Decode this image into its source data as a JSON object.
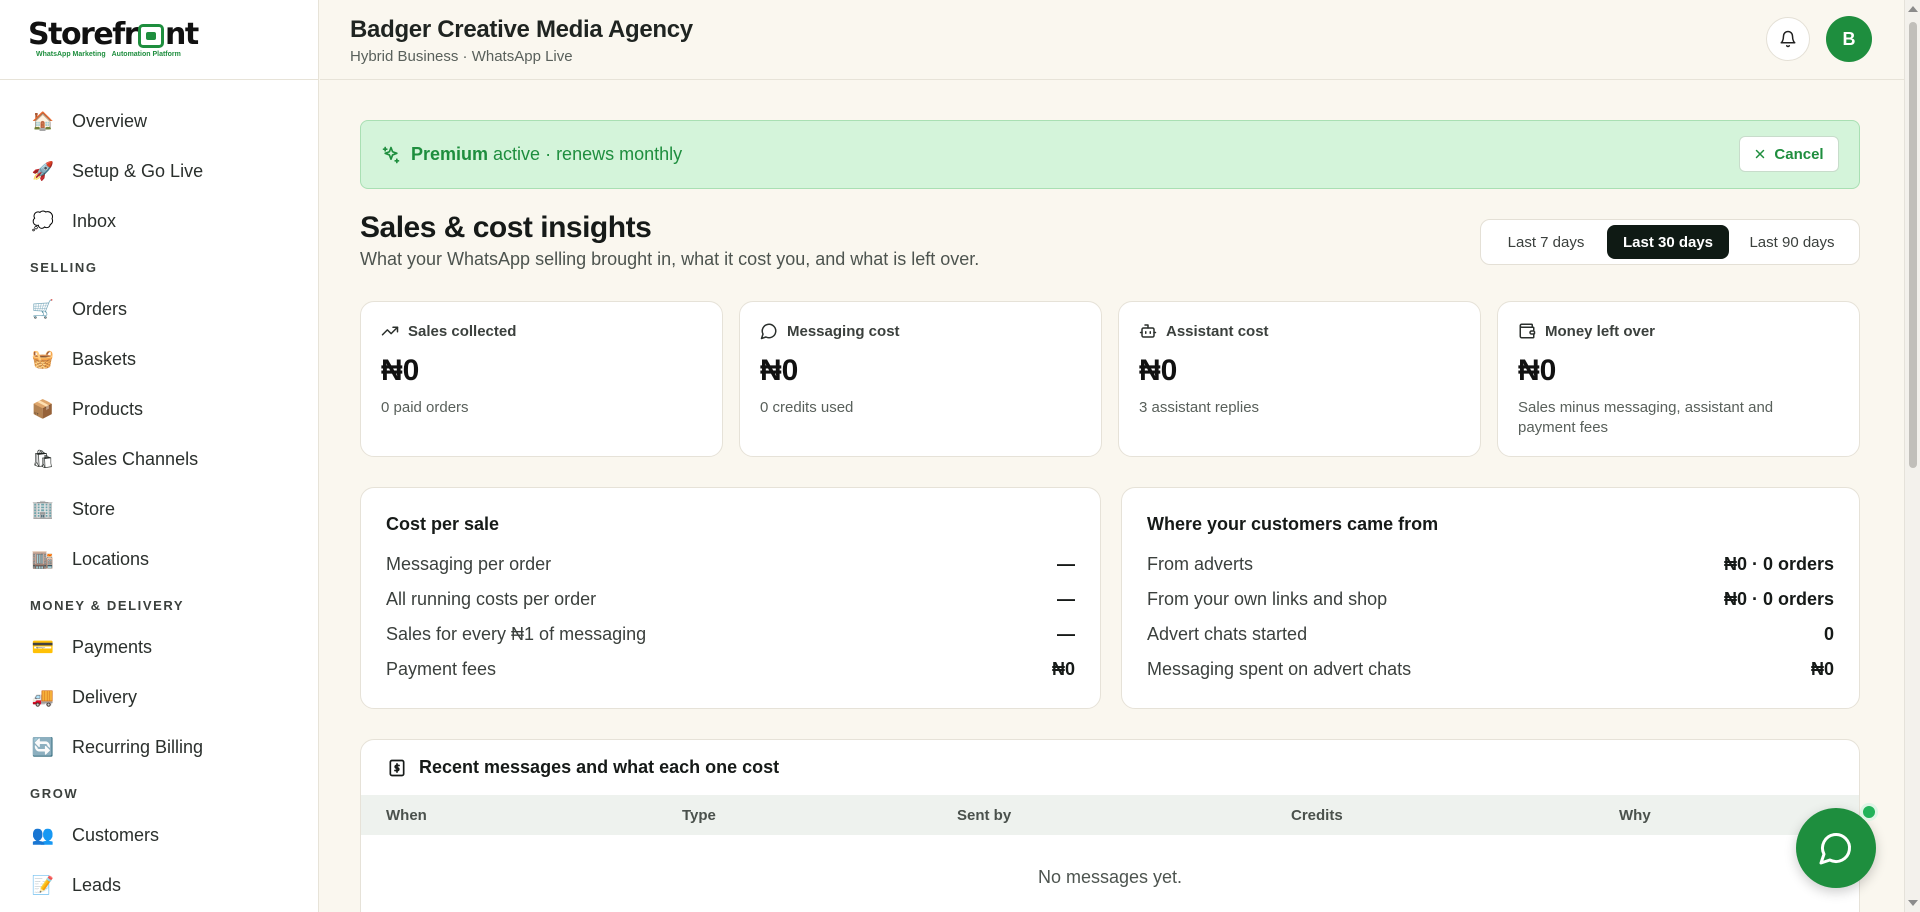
{
  "brand": {
    "logo_text_1": "Storefr",
    "logo_text_2": "nt",
    "tagline_1": "WhatsApp Marketing",
    "tagline_2": "Automation Platform"
  },
  "header": {
    "business_name": "Badger Creative Media Agency",
    "business_sub": "Hybrid Business · WhatsApp Live",
    "avatar_initial": "B"
  },
  "sidebar": {
    "top_items": [
      {
        "label": "Overview",
        "icon": "🏠"
      },
      {
        "label": "Setup & Go Live",
        "icon": "🚀"
      },
      {
        "label": "Inbox",
        "icon": "💭"
      }
    ],
    "selling_title": "SELLING",
    "selling_items": [
      {
        "label": "Orders",
        "icon": "🛒"
      },
      {
        "label": "Baskets",
        "icon": "🧺"
      },
      {
        "label": "Products",
        "icon": "📦"
      },
      {
        "label": "Sales Channels",
        "icon": "🛍"
      },
      {
        "label": "Store",
        "icon": "🏢"
      },
      {
        "label": "Locations",
        "icon": "🏬"
      }
    ],
    "money_title": "MONEY & DELIVERY",
    "money_items": [
      {
        "label": "Payments",
        "icon": "💳"
      },
      {
        "label": "Delivery",
        "icon": "🚚"
      },
      {
        "label": "Recurring Billing",
        "icon": "🔄"
      }
    ],
    "grow_title": "GROW",
    "grow_items": [
      {
        "label": "Customers",
        "icon": "👥"
      },
      {
        "label": "Leads",
        "icon": "📝"
      }
    ]
  },
  "banner": {
    "plan": "Premium",
    "status": "active · renews monthly",
    "cancel_label": "Cancel"
  },
  "page": {
    "title": "Sales & cost insights",
    "subtitle": "What your WhatsApp selling brought in, what it cost you, and what is left over.",
    "ranges": [
      "Last 7 days",
      "Last 30 days",
      "Last 90 days"
    ],
    "selected_range": "Last 30 days"
  },
  "stats": [
    {
      "label": "Sales collected",
      "value": "₦0",
      "note": "0 paid orders",
      "icon": "trending-up-icon"
    },
    {
      "label": "Messaging cost",
      "value": "₦0",
      "note": "0 credits used",
      "icon": "message-icon"
    },
    {
      "label": "Assistant cost",
      "value": "₦0",
      "note": "3 assistant replies",
      "icon": "bot-icon"
    },
    {
      "label": "Money left over",
      "value": "₦0",
      "note": "Sales minus messaging, assistant and payment fees",
      "icon": "wallet-icon"
    }
  ],
  "cost_per_sale": {
    "title": "Cost per sale",
    "rows": [
      {
        "label": "Messaging per order",
        "value": "—"
      },
      {
        "label": "All running costs per order",
        "value": "—"
      },
      {
        "label": "Sales for every ₦1 of messaging",
        "value": "—"
      },
      {
        "label": "Payment fees",
        "value": "₦0"
      }
    ]
  },
  "customer_sources": {
    "title": "Where your customers came from",
    "rows": [
      {
        "label": "From adverts",
        "value": "₦0 · 0 orders"
      },
      {
        "label": "From your own links and shop",
        "value": "₦0 · 0 orders"
      },
      {
        "label": "Advert chats started",
        "value": "0"
      },
      {
        "label": "Messaging spent on advert chats",
        "value": "₦0"
      }
    ]
  },
  "messages": {
    "title": "Recent messages and what each one cost",
    "columns": [
      "When",
      "Type",
      "Sent by",
      "Credits",
      "Why"
    ],
    "empty_text": "No messages yet."
  },
  "colors": {
    "brand_green": "#1e8e3e",
    "banner_bg": "#d4f4da",
    "page_bg": "#faf7ef",
    "selected_range_bg": "#0f1a14"
  }
}
